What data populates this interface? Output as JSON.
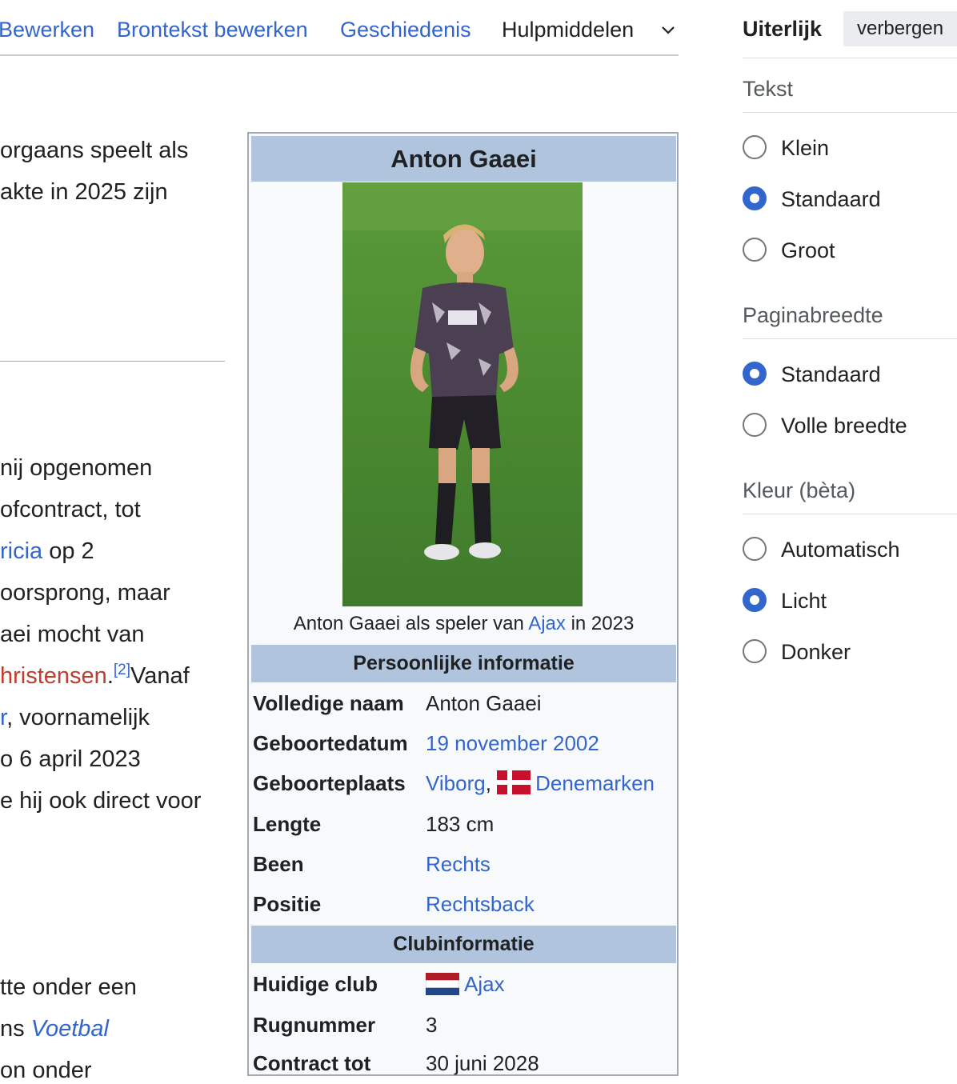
{
  "tabs": {
    "edit": "Bewerken",
    "edit_source": "Brontekst bewerken",
    "history": "Geschiedenis",
    "tools": "Hulpmiddelen"
  },
  "article": {
    "p1_l1": "orgaans speelt als",
    "p1_l2": "akte in 2025 zijn",
    "p2_l1": "nij opgenomen",
    "p2_l2": "ofcontract, tot",
    "p2_l3_link": "ricia",
    "p2_l3_rest": " op 2",
    "p2_l4": "oorsprong, maar",
    "p2_l5": "aei mocht van",
    "p2_l6_link": "hristensen",
    "p2_l6_dot": ".",
    "p2_l6_ref": "[2]",
    "p2_l6_rest": "Vanaf",
    "p2_l7_link": "r",
    "p2_l7_rest": ", voornamelijk",
    "p2_l8": "o 6 april 2023",
    "p2_l9": "e hij ook direct voor",
    "p3_l1": "tte onder een",
    "p3_l2_pre": "ns ",
    "p3_l2_link": "Voetbal",
    "p3_l3": "on onder"
  },
  "infobox": {
    "title": "Anton Gaaei",
    "caption_pre": "Anton Gaaei als speler van ",
    "caption_link": "Ajax",
    "caption_post": " in 2023",
    "section_personal": "Persoonlijke informatie",
    "section_club": "Clubinformatie",
    "personal": {
      "full_name_label": "Volledige naam",
      "full_name": "Anton Gaaei",
      "birth_date_label": "Geboortedatum",
      "birth_date": "19 november 2002",
      "birth_place_label": "Geboorteplaats",
      "birth_city": "Viborg",
      "birth_sep": ",",
      "birth_country": "Denemarken",
      "height_label": "Lengte",
      "height": "183 cm",
      "foot_label": "Been",
      "foot": "Rechts",
      "position_label": "Positie",
      "position": "Rechtsback"
    },
    "club": {
      "current_club_label": "Huidige club",
      "current_club": "Ajax",
      "number_label": "Rugnummer",
      "number": "3",
      "contract_label": "Contract tot",
      "contract": "30 juni 2028"
    }
  },
  "appearance": {
    "title": "Uiterlijk",
    "hide_button": "verbergen",
    "text_heading": "Tekst",
    "text_options": [
      "Klein",
      "Standaard",
      "Groot"
    ],
    "text_selected": "Standaard",
    "width_heading": "Paginabreedte",
    "width_options": [
      "Standaard",
      "Volle breedte"
    ],
    "width_selected": "Standaard",
    "color_heading": "Kleur (bèta)",
    "color_options": [
      "Automatisch",
      "Licht",
      "Donker"
    ],
    "color_selected": "Licht"
  },
  "colors": {
    "link": "#3366cc",
    "redlink": "#bf3c2c",
    "infobox_header": "#b0c4de",
    "radio_selected": "#3366cc"
  }
}
